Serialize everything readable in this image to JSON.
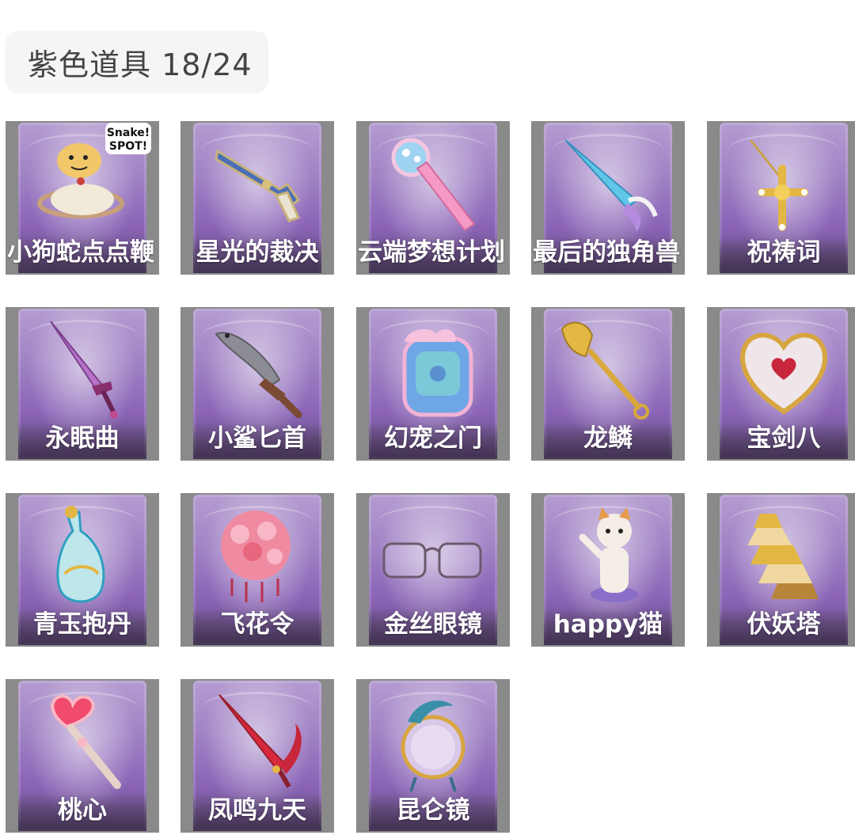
{
  "header": {
    "title": "紫色道具 18/24"
  },
  "items": [
    {
      "name": "小狗蛇点点鞭",
      "icon": "snake-whip-icon",
      "badge": "Snake! SPOT!"
    },
    {
      "name": "星光的裁决",
      "icon": "flintlock-pistol-icon"
    },
    {
      "name": "云端梦想计划",
      "icon": "dream-scepter-icon"
    },
    {
      "name": "最后的独角兽",
      "icon": "unicorn-horn-lance-icon"
    },
    {
      "name": "祝祷词",
      "icon": "golden-cross-pendant-icon"
    },
    {
      "name": "永眠曲",
      "icon": "purple-sword-icon"
    },
    {
      "name": "小鲨匕首",
      "icon": "shark-dagger-icon"
    },
    {
      "name": "幻宠之门",
      "icon": "pet-gate-device-icon"
    },
    {
      "name": "龙鳞",
      "icon": "golden-shovel-icon"
    },
    {
      "name": "宝剑八",
      "icon": "heart-shield-icon"
    },
    {
      "name": "青玉抱丹",
      "icon": "jade-vase-icon"
    },
    {
      "name": "飞花令",
      "icon": "flower-bouquet-icon"
    },
    {
      "name": "金丝眼镜",
      "icon": "gold-glasses-icon"
    },
    {
      "name": "happy猫",
      "icon": "happy-cat-figurine-icon"
    },
    {
      "name": "伏妖塔",
      "icon": "pagoda-tower-icon"
    },
    {
      "name": "桃心",
      "icon": "heart-wand-icon"
    },
    {
      "name": "凤鸣九天",
      "icon": "phoenix-red-sword-icon"
    },
    {
      "name": "昆仑镜",
      "icon": "kunlun-mirror-icon"
    }
  ]
}
